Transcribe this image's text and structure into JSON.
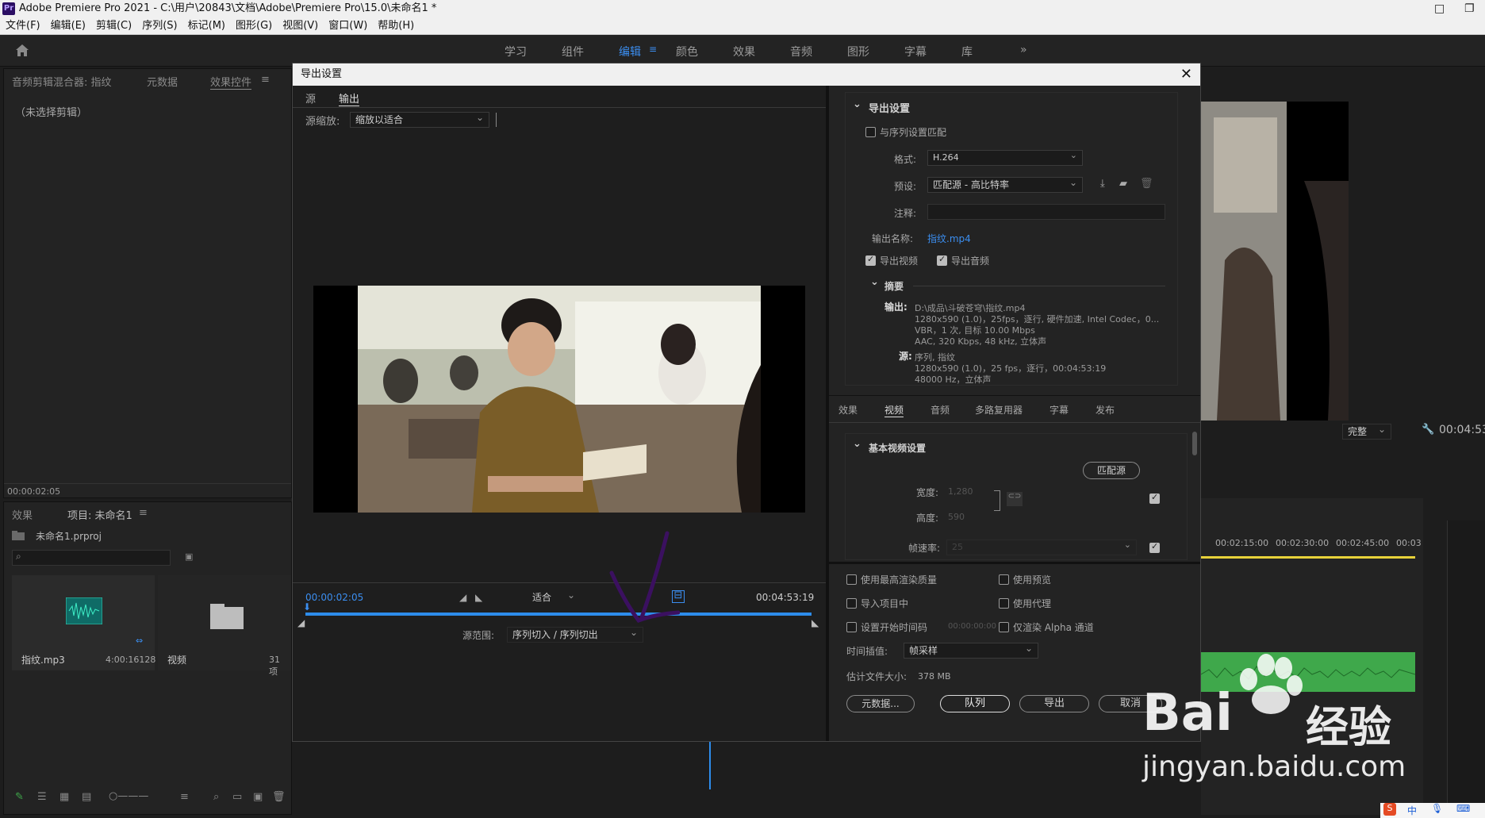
{
  "window": {
    "title": "Adobe Premiere Pro 2021 - C:\\用户\\20843\\文档\\Adobe\\Premiere Pro\\15.0\\未命名1 *",
    "app_icon": "Pr"
  },
  "menu": [
    "文件(F)",
    "编辑(E)",
    "剪辑(C)",
    "序列(S)",
    "标记(M)",
    "图形(G)",
    "视图(V)",
    "窗口(W)",
    "帮助(H)"
  ],
  "workspaces": [
    "学习",
    "组件",
    "编辑",
    "颜色",
    "效果",
    "音频",
    "图形",
    "字幕",
    "库"
  ],
  "active_workspace": "编辑",
  "source_panel": {
    "tabs": [
      "音频剪辑混合器: 指纹",
      "元数据",
      "效果控件"
    ],
    "empty_text": "（未选择剪辑）",
    "timecode": "00:00:02:05"
  },
  "project_panel": {
    "tabs": [
      "效果",
      "项目: 未命名1"
    ],
    "project_file": "未命名1.prproj",
    "items": [
      {
        "name": "指纹.mp3",
        "duration": "4:00:16128"
      },
      {
        "name": "视频",
        "count": "31 项"
      }
    ]
  },
  "dialog": {
    "title": "导出设置",
    "left_tabs": [
      "源",
      "输出"
    ],
    "source_scaling_label": "源缩放:",
    "source_scaling_value": "缩放以适合",
    "timecode_in": "00:00:02:05",
    "timecode_out": "00:04:53:19",
    "fit_value": "适合",
    "source_range_label": "源范围:",
    "source_range_value": "序列切入 / 序列切出",
    "export_settings": {
      "section_title": "导出设置",
      "match_sequence": "与序列设置匹配",
      "format_label": "格式:",
      "format_value": "H.264",
      "preset_label": "预设:",
      "preset_value": "匹配源 - 高比特率",
      "comments_label": "注释:",
      "output_name_label": "输出名称:",
      "output_name_value": "指纹.mp4",
      "export_video": "导出视频",
      "export_audio": "导出音频",
      "summary_title": "摘要",
      "output_label": "输出:",
      "output_lines": [
        "D:\\成品\\斗破苍穹\\指纹.mp4",
        "1280x590 (1.0)，25fps，逐行, 硬件加速, Intel Codec，0...",
        "VBR，1 次, 目标 10.00 Mbps",
        "AAC, 320 Kbps, 48 kHz, 立体声"
      ],
      "source_label": "源:",
      "source_lines": [
        "序列, 指纹",
        "1280x590 (1.0)，25 fps，逐行，00:04:53:19",
        "48000 Hz，立体声"
      ]
    },
    "settings_tabs": [
      "效果",
      "视频",
      "音频",
      "多路复用器",
      "字幕",
      "发布"
    ],
    "active_settings_tab": "视频",
    "basic_video": {
      "title": "基本视频设置",
      "match_source_btn": "匹配源",
      "width_label": "宽度:",
      "width_value": "1,280",
      "height_label": "高度:",
      "height_value": "590",
      "framerate_label": "帧速率:",
      "framerate_value": "25"
    },
    "options": {
      "max_render_quality": "使用最高渲染质量",
      "use_previews": "使用预览",
      "import_into_project": "导入项目中",
      "use_proxies": "使用代理",
      "set_start_timecode": "设置开始时间码",
      "start_timecode_value": "00:00:00:00",
      "render_alpha_only": "仅渲染 Alpha 通道",
      "time_interpolation_label": "时间插值:",
      "time_interpolation_value": "帧采样",
      "file_size_label": "估计文件大小:",
      "file_size_value": "378 MB"
    },
    "buttons": {
      "metadata": "元数据...",
      "queue": "队列",
      "export": "导出",
      "cancel": "取消"
    }
  },
  "program_panel": {
    "timecode": "00:04:53",
    "quality": "完整",
    "ruler": [
      "00:02:15:00",
      "00:02:30:00",
      "00:02:45:00",
      "00:03"
    ]
  },
  "watermark": {
    "text": "Bai",
    "text2": "经验",
    "url": "jingyan.baidu.com"
  },
  "taskbar": {
    "ime": "中"
  },
  "colors": {
    "accent": "#2d8ceb",
    "dialog_bg": "#232323",
    "audio_clip": "#3fa84b",
    "annotation": "#3b1060"
  }
}
